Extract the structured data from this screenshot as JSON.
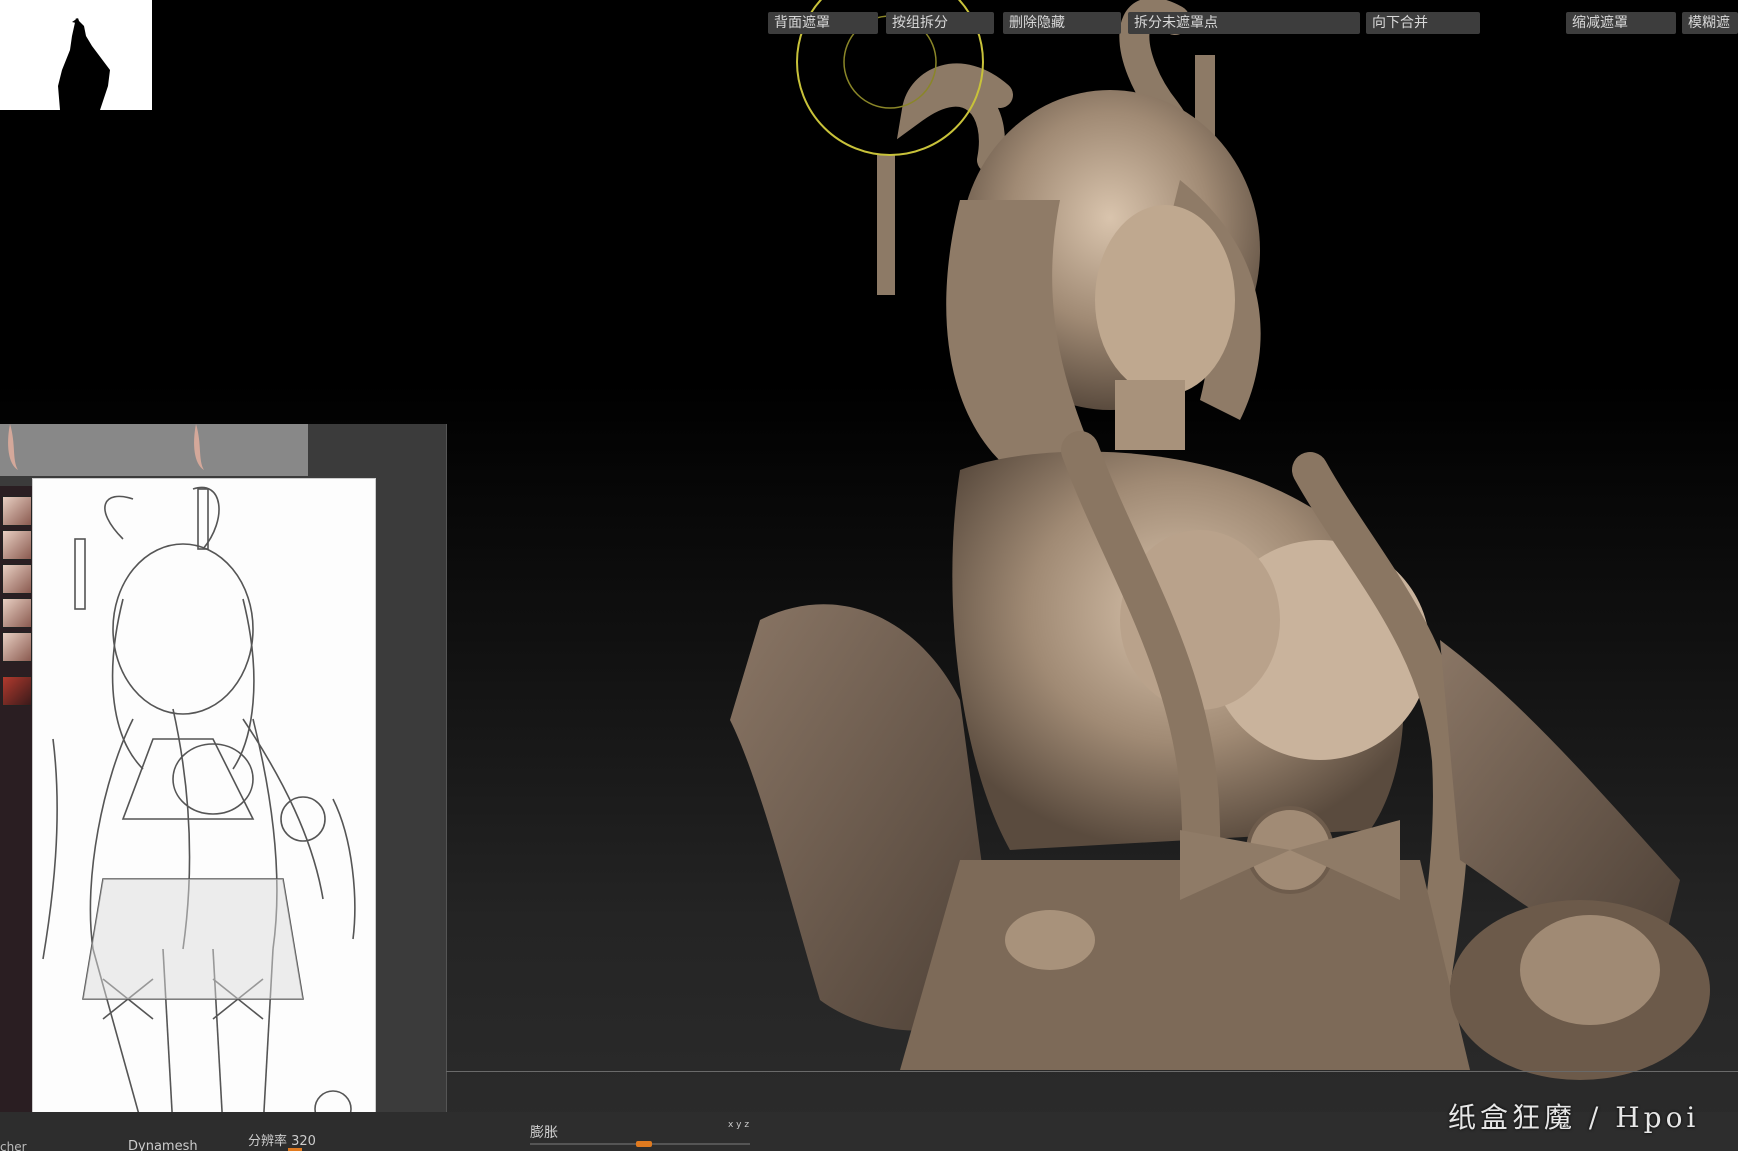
{
  "toolbar": {
    "inflate_label": "膨胀",
    "xyz_label": "x y z",
    "backface_mask": "背面遮罩",
    "split_by_groups": "按组拆分",
    "delete_hidden": "删除隐藏",
    "split_unmasked_points": "拆分未遮罩点",
    "merge_down": "向下合并",
    "shrink_mask": "缩减遮罩",
    "blur_mask": "模糊遮",
    "dynamesh_label": "Dynamesh",
    "resolution_label": "分辨率 320",
    "left_cut_label": "cher"
  },
  "watermark": "纸盒狂魔 / Hpoi",
  "colors": {
    "accent": "#e07a1f",
    "brush_cursor": "#c8c23a",
    "clay": "#a89582"
  },
  "icons": {
    "brush_cursor": "brush-cursor-icon",
    "navigator": "navigator-thumbnail"
  }
}
